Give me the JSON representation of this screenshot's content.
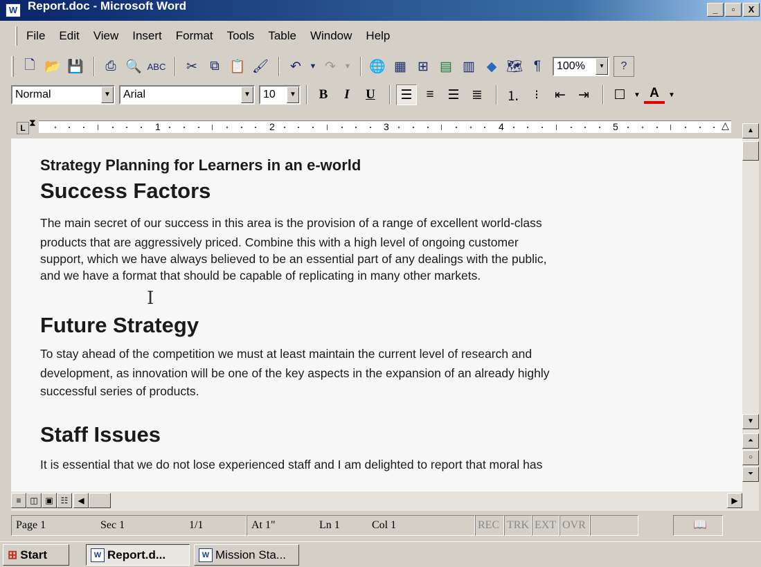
{
  "window": {
    "title": "Report.doc - Microsoft Word",
    "icon": "word-doc-icon"
  },
  "menu": [
    "File",
    "Edit",
    "View",
    "Insert",
    "Format",
    "Tools",
    "Table",
    "Window",
    "Help"
  ],
  "standard_toolbar": {
    "zoom": "100%",
    "zoom_arrow": "▾",
    "help_glyph": "?"
  },
  "formatting_toolbar": {
    "style": "Normal",
    "font": "Arial",
    "size": "10",
    "bold": "B",
    "italic": "I",
    "underline": "U",
    "font_color_glyph": "A",
    "font_color": "#e00000"
  },
  "ruler": {
    "numbers": [
      "1",
      "2",
      "3",
      "4",
      "5"
    ]
  },
  "document": {
    "header": "Strategy Planning for Learners in an e-world",
    "sections": [
      {
        "heading": "Success Factors",
        "lines": [
          "The main secret of our success in this area is the provision of a range of excellent world-class",
          "products that are aggressively priced. Combine this with a high level of ongoing customer",
          "support, which we have always believed to be an essential part of any dealings with the public,",
          "and we have a format that should be capable of replicating in many other markets."
        ]
      },
      {
        "heading": "Future Strategy",
        "lines": [
          "To stay ahead of the competition we must at least maintain the current level of research and",
          "development, as innovation will be one of the key aspects in the expansion of an already highly",
          "successful series of products."
        ]
      },
      {
        "heading": "Staff Issues",
        "lines": [
          "It is essential that we do not lose experienced staff and I am delighted to report that moral has"
        ]
      }
    ]
  },
  "statusbar": {
    "page": "Page 1",
    "sec": "Sec 1",
    "pages": "1/1",
    "at": "At 1\"",
    "ln": "Ln 1",
    "col": "Col 1",
    "rec": "REC",
    "trk": "TRK",
    "ext": "EXT",
    "ovr": "OVR"
  },
  "taskbar": {
    "start": "Start",
    "tasks": [
      "Report.d...",
      "Mission Sta..."
    ]
  }
}
